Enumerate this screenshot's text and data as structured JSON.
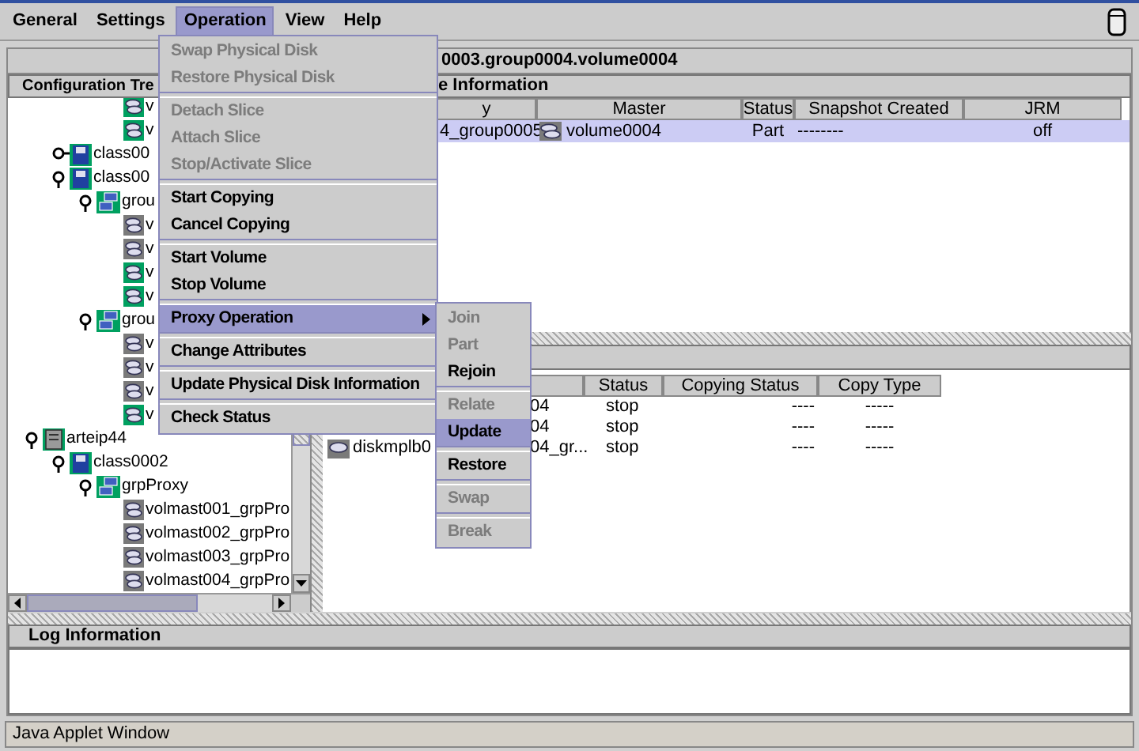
{
  "menu_bar": {
    "items": [
      {
        "label": "General",
        "selected": false
      },
      {
        "label": "Settings",
        "selected": false
      },
      {
        "label": "Operation",
        "selected": true
      },
      {
        "label": "View",
        "selected": false
      },
      {
        "label": "Help",
        "selected": false
      }
    ]
  },
  "path": "0003.group0004.volume0004",
  "tree": {
    "title": "Configuration Tre",
    "nodes": [
      {
        "children": [
          {
            "children": [
              {
                "children": [
                  {
                    "kind": "volume",
                    "label": "v",
                    "highlighted": true
                  },
                  {
                    "kind": "volume",
                    "label": "v",
                    "highlighted": true
                  }
                ]
              }
            ]
          },
          {
            "kind": "class",
            "label": "class00",
            "expanded": false
          },
          {
            "kind": "class",
            "label": "class00",
            "expanded": true,
            "children": [
              {
                "kind": "group",
                "label": "grou",
                "expanded": true,
                "children": [
                  {
                    "kind": "volume",
                    "label": "v",
                    "highlighted": false
                  },
                  {
                    "kind": "volume",
                    "label": "v",
                    "highlighted": false
                  },
                  {
                    "kind": "volume",
                    "label": "v",
                    "highlighted": true
                  },
                  {
                    "kind": "volume",
                    "label": "v",
                    "highlighted": true
                  }
                ]
              },
              {
                "kind": "group",
                "label": "grou",
                "expanded": true,
                "children": [
                  {
                    "kind": "volume",
                    "label": "v",
                    "highlighted": false
                  },
                  {
                    "kind": "volume",
                    "label": "v",
                    "highlighted": false
                  },
                  {
                    "kind": "volume",
                    "label": "v",
                    "highlighted": false
                  },
                  {
                    "kind": "volume",
                    "label": "v",
                    "highlighted": true
                  }
                ]
              }
            ]
          }
        ]
      },
      {
        "kind": "host",
        "label": "arteip44",
        "expanded": true,
        "children": [
          {
            "kind": "class",
            "label": "class0002",
            "expanded": true,
            "children": [
              {
                "kind": "group",
                "label": "grpProxy",
                "expanded": true,
                "children": [
                  {
                    "kind": "volume",
                    "label": "volmast001_grpPro",
                    "highlighted": false
                  },
                  {
                    "kind": "volume",
                    "label": "volmast002_grpPro",
                    "highlighted": false
                  },
                  {
                    "kind": "volume",
                    "label": "volmast003_grpPro",
                    "highlighted": false
                  },
                  {
                    "kind": "volume",
                    "label": "volmast004_grpPro",
                    "highlighted": false
                  }
                ]
              }
            ]
          }
        ]
      }
    ]
  },
  "volume_information": {
    "title": "e Information",
    "columns": [
      "y",
      "Master",
      "Status",
      "Snapshot Created",
      "JRM"
    ],
    "rows": [
      {
        "selected": true,
        "cells": [
          "4_group0005",
          "volume0004",
          "Part",
          "--------",
          "off"
        ]
      }
    ]
  },
  "copy_table": {
    "columns": [
      "Status",
      "Copying Status",
      "Copy Type"
    ],
    "rows": [
      {
        "column_2": "04",
        "status": "stop",
        "copying_status": "----",
        "copy_type": "-----"
      },
      {
        "column_2": "04",
        "status": "stop",
        "copying_status": "----",
        "copy_type": "-----"
      },
      {
        "column_1": "diskmplb0",
        "column_2": "04_gr...",
        "status": "stop",
        "copying_status": "----",
        "copy_type": "-----"
      }
    ]
  },
  "log": {
    "title": "Log Information"
  },
  "operation_menu": {
    "groups": [
      [
        {
          "label": "Swap Physical Disk",
          "disabled": true,
          "selected": false,
          "has_submenu": false
        },
        {
          "label": "Restore Physical Disk",
          "disabled": true,
          "selected": false,
          "has_submenu": false
        }
      ],
      [
        {
          "label": "Detach Slice",
          "disabled": true,
          "selected": false,
          "has_submenu": false
        },
        {
          "label": "Attach Slice",
          "disabled": true,
          "selected": false,
          "has_submenu": false
        },
        {
          "label": "Stop/Activate Slice",
          "disabled": true,
          "selected": false,
          "has_submenu": false
        }
      ],
      [
        {
          "label": "Start Copying",
          "disabled": false,
          "selected": false,
          "has_submenu": false
        },
        {
          "label": "Cancel Copying",
          "disabled": false,
          "selected": false,
          "has_submenu": false
        }
      ],
      [
        {
          "label": "Start Volume",
          "disabled": false,
          "selected": false,
          "has_submenu": false
        },
        {
          "label": "Stop Volume",
          "disabled": false,
          "selected": false,
          "has_submenu": false
        }
      ],
      [
        {
          "label": "Proxy Operation",
          "disabled": false,
          "selected": true,
          "has_submenu": true
        }
      ],
      [
        {
          "label": "Change Attributes",
          "disabled": false,
          "selected": false,
          "has_submenu": false
        }
      ],
      [
        {
          "label": "Update Physical Disk Information",
          "disabled": false,
          "selected": false,
          "has_submenu": false
        }
      ],
      [
        {
          "label": "Check Status",
          "disabled": false,
          "selected": false,
          "has_submenu": false
        }
      ]
    ]
  },
  "proxy_submenu": {
    "groups": [
      [
        {
          "label": "Join",
          "disabled": true,
          "selected": false
        },
        {
          "label": "Part",
          "disabled": true,
          "selected": false
        },
        {
          "label": "Rejoin",
          "disabled": false,
          "selected": false
        }
      ],
      [
        {
          "label": "Relate",
          "disabled": true,
          "selected": false
        },
        {
          "label": "Update",
          "disabled": false,
          "selected": true
        }
      ],
      [
        {
          "label": "Restore",
          "disabled": false,
          "selected": false
        }
      ],
      [
        {
          "label": "Swap",
          "disabled": true,
          "selected": false
        }
      ],
      [
        {
          "label": "Break",
          "disabled": true,
          "selected": false
        }
      ]
    ]
  },
  "status_bar": "Java Applet Window"
}
